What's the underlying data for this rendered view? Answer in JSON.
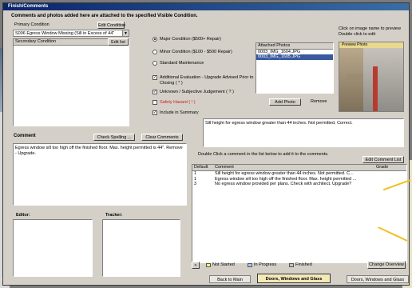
{
  "window": {
    "title": "Finish/Comments"
  },
  "header": {
    "instruction": "Comments and photos added here are attached to the specified Visible Condition."
  },
  "primary": {
    "label": "Primary Condition",
    "edit_label": "Edit Condition",
    "value": "S006 Egress Window Missing (Sill in Excess of 44\""
  },
  "secondary": {
    "label": "Secondary Condition",
    "edit_label": "Edit list"
  },
  "condition_type": {
    "options": [
      "Major Condition ($500+ Repair)",
      "Minor Condition ($100 - $500 Repair)",
      "Standard Maintenance"
    ],
    "selected_index": 0
  },
  "checks": {
    "items": [
      {
        "label": "Additional Evaluation - Upgrade Advised Prior to Closing ( * )",
        "checked": true
      },
      {
        "label": "Unknown / Subjective Judgement ( ? )",
        "checked": true
      },
      {
        "label": "Safety Hazard ( ! )",
        "checked": false,
        "color": "#c81e1e"
      },
      {
        "label": "Include in Summary",
        "checked": true
      }
    ]
  },
  "photos": {
    "header": "Attached Photos",
    "items": [
      "0003_IMG_1604.JPG",
      "0003_IMG_1605.JPG"
    ],
    "selected_index": 1,
    "add_label": "Add Photo",
    "remove_label": "Remove"
  },
  "preview": {
    "hint_line1": "Click on image name to preview",
    "hint_line2": "Double click to edit",
    "title": "Preview Photo"
  },
  "comment": {
    "label": "Comment",
    "spell_label": "Check Spelling ...",
    "clear_label": "Clear Comments",
    "text": "Egress window sill too high off the finished floor. Max. height permitted is 44\". Remove - Upgrade."
  },
  "selected_comment": {
    "text": "Sill height for egress window greater than 44 inches. Not permitted. Correct."
  },
  "list_hint": "Double Click a comment in the list below to add it to the comments.",
  "edit_list_label": "Edit Comment List",
  "grid": {
    "columns": [
      "Default",
      "Comment",
      "Grade"
    ],
    "rows": [
      {
        "def": "1",
        "comment": "Sill height for egress window greater than 44 inches. Not permitted. C...",
        "grade": ""
      },
      {
        "def": "1",
        "comment": "Egress window sill too high off the finished floor. Max. height permitted ...",
        "grade": ""
      },
      {
        "def": "3",
        "comment": "No egress window provided per plans. Check with architect. Upgrade?",
        "grade": ""
      }
    ]
  },
  "status_legend": [
    {
      "label": "Not Started",
      "color": "#ffff66"
    },
    {
      "label": "In Progress",
      "color": "#a8c8ff"
    },
    {
      "label": "Finished",
      "color": "#c0c0c0"
    }
  ],
  "scroll_left": "<",
  "change_overview_label": "Change Overview",
  "editor": {
    "label": "Editor:"
  },
  "tracker": {
    "label": "Tracker:"
  },
  "tabs": [
    "Back to Main",
    "Doors, Windows and Glass",
    "Doors, Windows and Glass"
  ],
  "active_tab": 1,
  "corner_char": "6"
}
